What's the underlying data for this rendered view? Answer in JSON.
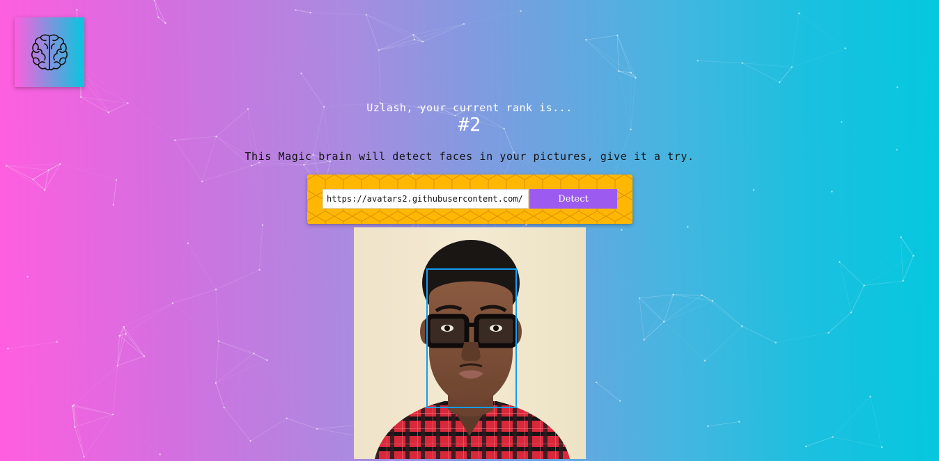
{
  "app": {
    "logo_icon": "brain-icon"
  },
  "rank": {
    "message": "Uzlash, your current rank is...",
    "value": "#2"
  },
  "tagline": "This Magic brain will detect faces in your pictures, give it a try.",
  "form": {
    "url_value": "https://avatars2.githubusercontent.com/",
    "detect_label": "Detect"
  },
  "result": {
    "image_icon": "portrait-photo",
    "face_count": 1
  },
  "colors": {
    "gradient_left": "#ff5edf",
    "gradient_right": "#04c8de",
    "form_panel": "#ffb703",
    "detect_button": "#9c5af0",
    "face_box": "#149df2"
  }
}
